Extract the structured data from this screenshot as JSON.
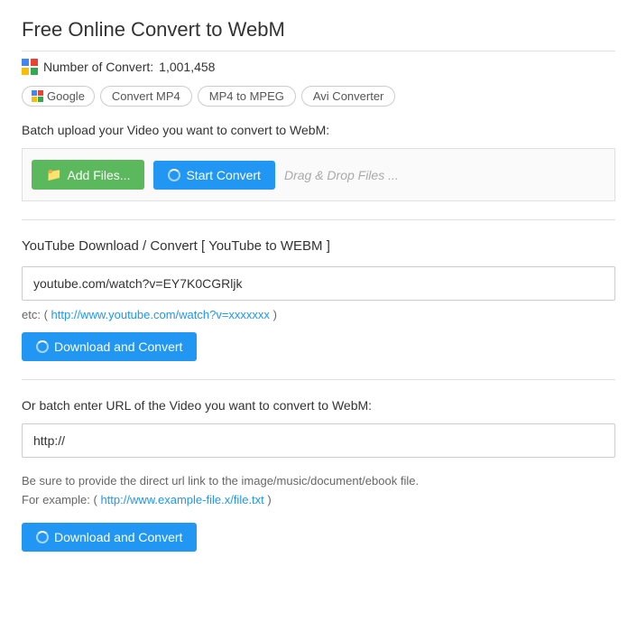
{
  "page": {
    "title": "Free Online Convert to WebM"
  },
  "stats": {
    "label": "Number of Convert:",
    "count": "1,001,458"
  },
  "nav": {
    "google_label": "Google",
    "link1": "Convert MP4",
    "link2": "MP4 to MPEG",
    "link3": "Avi Converter"
  },
  "upload": {
    "section_label": "Batch upload your Video you want to convert to WebM:",
    "add_files_btn": "Add Files...",
    "start_convert_btn": "Start Convert",
    "drag_drop_text": "Drag & Drop Files ..."
  },
  "youtube": {
    "section_title": "YouTube Download / Convert [ YouTube to WEBM ]",
    "url_value": "youtube.com/watch?v=EY7K0CGRljk",
    "url_placeholder": "",
    "hint_prefix": "etc: (",
    "hint_url": "http://www.youtube.com/watch?v=xxxxxxx",
    "hint_suffix": ")",
    "btn_label": "Download and Convert"
  },
  "batch_url": {
    "section_label": "Or batch enter URL of the Video you want to convert to WebM:",
    "url_placeholder": "http://",
    "hint_line1": "Be sure to provide the direct url link to the image/music/document/ebook file.",
    "hint_line2_prefix": "For example: (",
    "hint_link": "http://www.example-file.x/file.txt",
    "hint_line2_suffix": ")",
    "btn_label": "Download and Convert"
  }
}
